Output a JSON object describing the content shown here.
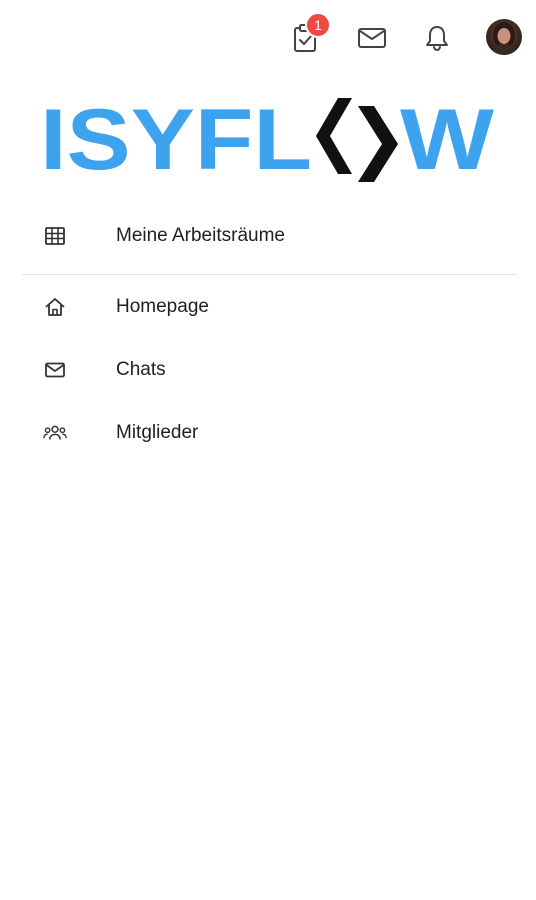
{
  "header": {
    "tasks_badge_count": "1",
    "icons": {
      "tasks": "clipboard-check-icon",
      "messages": "envelope-icon",
      "notifications": "bell-icon",
      "profile": "avatar"
    }
  },
  "logo": {
    "text_left": "ISYFL",
    "text_right": "W",
    "brand_blue": "#3ea3ef",
    "mark_color": "#111111"
  },
  "menu": {
    "workspaces": {
      "label": "Meine Arbeitsräume",
      "icon": "table-grid-icon"
    },
    "items": [
      {
        "label": "Homepage",
        "icon": "home-icon"
      },
      {
        "label": "Chats",
        "icon": "envelope-icon"
      },
      {
        "label": "Mitglieder",
        "icon": "users-icon"
      }
    ]
  },
  "colors": {
    "badge": "#ee4a43",
    "divider": "#e0e0e0",
    "text": "#1f1f1f",
    "icon": "#333333"
  }
}
